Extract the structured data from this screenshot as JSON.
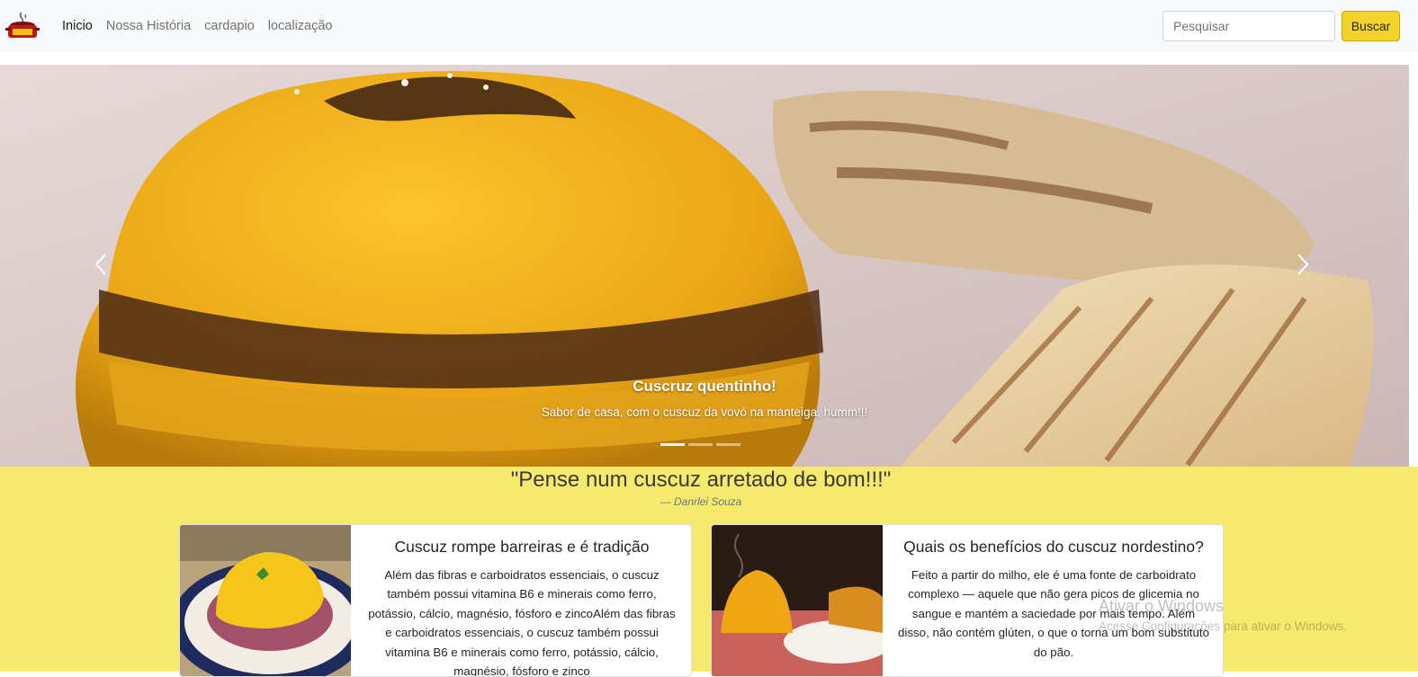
{
  "navbar": {
    "brand_text": "cuscuz",
    "links": [
      "Inicio",
      "Nossa História",
      "cardapio",
      "localização"
    ],
    "search_placeholder": "Pesquisar",
    "search_button": "Buscar"
  },
  "carousel": {
    "caption_title": "Cuscruz quentinho!",
    "caption_text": "Sabor de casa, com o cuscuz da vovó na manteiga, humm!!!",
    "active_slide": 1,
    "slide_count": 3
  },
  "quote": {
    "text": "\"Pense num cuscuz arretado de bom!!!\"",
    "author": "— Danrlei Souza"
  },
  "cards": [
    {
      "title": "Cuscuz rompe barreiras e é tradição",
      "text": "Além das fibras e carboidratos essenciais, o cuscuz também possui vitamina B6 e minerais como ferro, potássio, cálcio, magnésio, fósforo e zincoAlém das fibras e carboidratos essenciais, o cuscuz também possui vitamina B6 e minerais como ferro, potássio, cálcio, magnésio, fósforo e zinco"
    },
    {
      "title": "Quais os benefícios do cuscuz nordestino?",
      "text": "Feito a partir do milho, ele é uma fonte de carboidrato complexo — aquele que não gera picos de glicemia no sangue e mantém a saciedade por mais tempo. Além disso, não contém glúten, o que o torna um bom substituto do pão."
    }
  ],
  "watermark": {
    "title": "Ativar o Windows",
    "text": "Acesse Configurações para ativar o Windows."
  },
  "colors": {
    "accent_yellow": "#f6ea6e",
    "button_yellow": "#f2d32a",
    "navbar_bg": "#f8f9fa"
  }
}
